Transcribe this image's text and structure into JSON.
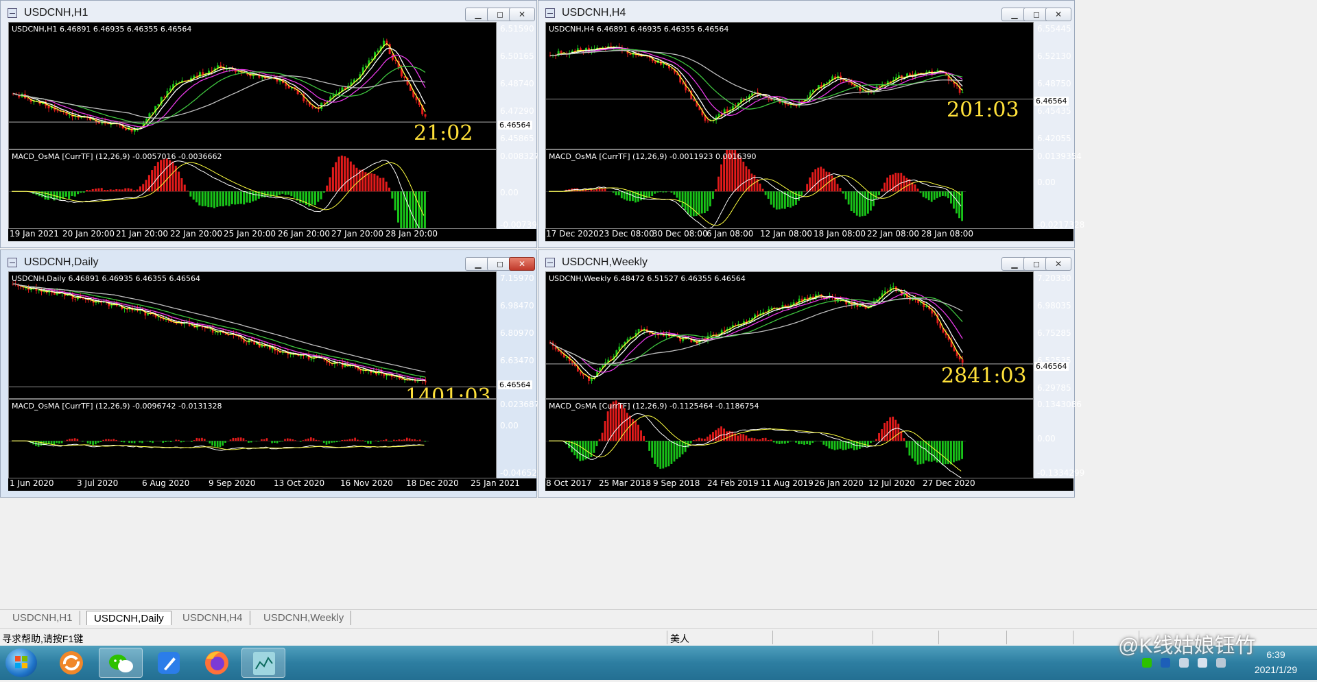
{
  "windows": {
    "h1": {
      "title": "USDCNH,H1",
      "header": "USDCNH,H1  6.46891 6.46935 6.46355 6.46564",
      "price_labels": [
        "6.51590",
        "6.50165",
        "6.48740",
        "6.47290",
        "6.45865"
      ],
      "current_price": "6.46564",
      "timer": "21:02",
      "macd_header": "MACD_OsMA [CurrTF] (12,26,9) -0.0057016 -0.0036662",
      "macd_labels": [
        "0.008327",
        "0.00",
        "-0.007393"
      ],
      "dates": [
        "19 Jan 2021",
        "20 Jan 20:00",
        "21 Jan 20:00",
        "22 Jan 20:00",
        "25 Jan 20:00",
        "26 Jan 20:00",
        "27 Jan 20:00",
        "28 Jan 20:00"
      ]
    },
    "h4": {
      "title": "USDCNH,H4",
      "header": "USDCNH,H4  6.46891 6.46935 6.46355 6.46564",
      "price_labels": [
        "6.55445",
        "6.52130",
        "6.48750",
        "6.45435",
        "6.42055"
      ],
      "current_price": "6.46564",
      "timer": "201:03",
      "macd_header": "MACD_OsMA [CurrTF] (12,26,9) -0.0011923 0.0016390",
      "macd_labels": [
        "0.0139354",
        "0.00",
        "-0.0217328"
      ],
      "dates": [
        "17 Dec 2020",
        "23 Dec 08:00",
        "30 Dec 08:00",
        "6 Jan 08:00",
        "12 Jan 08:00",
        "18 Jan 08:00",
        "22 Jan 08:00",
        "28 Jan 08:00"
      ]
    },
    "daily": {
      "title": "USDCNH,Daily",
      "header": "USDCNH,Daily  6.46891 6.46935 6.46355 6.46564",
      "price_labels": [
        "7.15970",
        "6.98470",
        "6.80970",
        "6.63470"
      ],
      "current_price": "6.46564",
      "timer": "1401:03",
      "macd_header": "MACD_OsMA [CurrTF] (12,26,9) -0.0096742 -0.0131328",
      "macd_labels": [
        "0.023687",
        "0.00",
        "-0.046526"
      ],
      "dates": [
        "1 Jun 2020",
        "3 Jul 2020",
        "6 Aug 2020",
        "9 Sep 2020",
        "13 Oct 2020",
        "16 Nov 2020",
        "18 Dec 2020",
        "25 Jan 2021"
      ]
    },
    "weekly": {
      "title": "USDCNH,Weekly",
      "header": "USDCNH,Weekly  6.48472 6.51527 6.46355 6.46564",
      "price_labels": [
        "7.20330",
        "6.98035",
        "6.75285",
        "6.52535",
        "6.29785"
      ],
      "current_price": "6.46564",
      "timer": "2841:03",
      "macd_header": "MACD_OsMA [CurrTF] (12,26,9) -0.1125464 -0.1186754",
      "macd_labels": [
        "0.1343086",
        "0.00",
        "-0.1334299"
      ],
      "dates": [
        "8 Oct 2017",
        "25 Mar 2018",
        "9 Sep 2018",
        "24 Feb 2019",
        "11 Aug 2019",
        "26 Jan 2020",
        "12 Jul 2020",
        "27 Dec 2020"
      ]
    }
  },
  "tabs": [
    "USDCNH,H1",
    "USDCNH,Daily",
    "USDCNH,H4",
    "USDCNH,Weekly"
  ],
  "active_tab": "USDCNH,Daily",
  "status": {
    "help": "寻求帮助,请按F1键",
    "profile": "美人"
  },
  "taskbar": {
    "time": "6:39",
    "date": "2021/1/29"
  },
  "watermark": "@K线姑娘钰竹",
  "colors": {
    "bull": "#19c419",
    "bear": "#e31b1b",
    "ma_yellow": "#ffff40",
    "ma_white": "#ffffff",
    "ma_magenta": "#e83ae8",
    "ma_green": "#3ec43e",
    "ma_silver": "#bfbfbf",
    "timer": "#ffe13a"
  }
}
